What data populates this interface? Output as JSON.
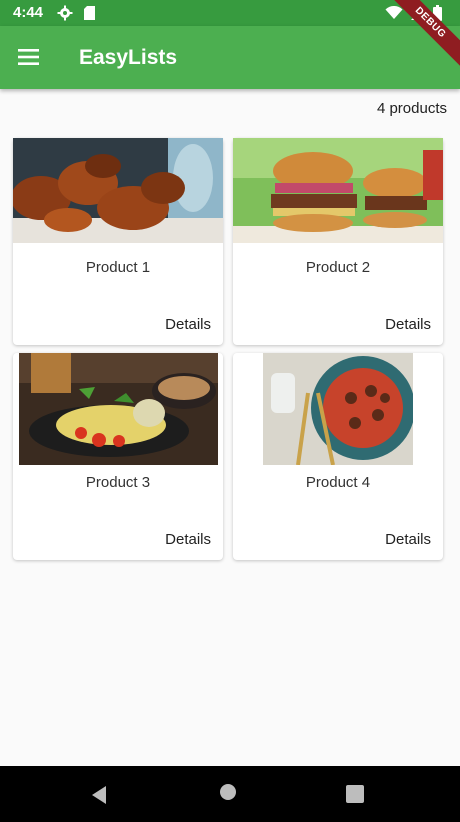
{
  "status_bar": {
    "time": "4:44"
  },
  "app_bar": {
    "title": "EasyLists",
    "debug_banner": "DEBUG"
  },
  "product_count": "4 products",
  "products": [
    {
      "title": "Product 1",
      "details_label": "Details"
    },
    {
      "title": "Product 2",
      "details_label": "Details"
    },
    {
      "title": "Product 3",
      "details_label": "Details"
    },
    {
      "title": "Product 4",
      "details_label": "Details"
    }
  ],
  "colors": {
    "status_bar": "#379b3f",
    "app_bar": "#4caf50",
    "debug": "#8f1d21",
    "nav_bar": "#000000"
  },
  "nav_icons": [
    "back-icon",
    "home-icon",
    "recents-icon"
  ]
}
